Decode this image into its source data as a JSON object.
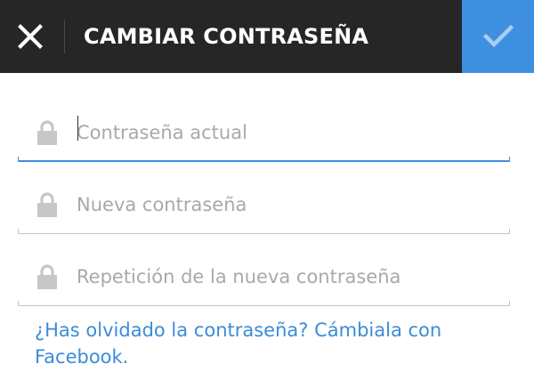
{
  "header": {
    "title": "CAMBIAR CONTRASEÑA",
    "close_icon": "close-icon",
    "confirm_icon": "check-icon",
    "background_color": "#262626",
    "accent_color": "#3f8fe0"
  },
  "form": {
    "fields": [
      {
        "placeholder": "Contraseña actual",
        "value": "",
        "icon": "lock-icon",
        "focused": true
      },
      {
        "placeholder": "Nueva contraseña",
        "value": "",
        "icon": "lock-icon",
        "focused": false
      },
      {
        "placeholder": "Repetición de la nueva contraseña",
        "value": "",
        "icon": "lock-icon",
        "focused": false
      }
    ],
    "forgot_link": "¿Has olvidado la contraseña? Cámbiala con Facebook.",
    "link_color": "#3b8cd8"
  }
}
